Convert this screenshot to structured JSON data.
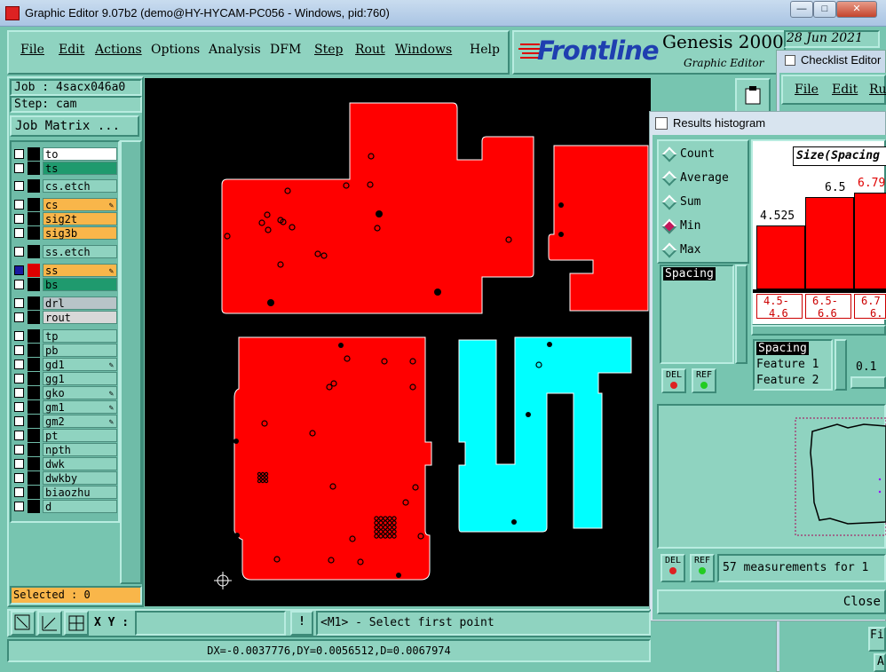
{
  "window": {
    "title": "Graphic Editor 9.07b2 (demo@HY-HYCAM-PC056 - Windows, pid:760)",
    "min": "—",
    "max": "□",
    "close": "✕"
  },
  "menu": [
    "File",
    "Edit",
    "Actions",
    "Options",
    "Analysis",
    "DFM",
    "Step",
    "Rout",
    "Windows",
    "Help"
  ],
  "brand": {
    "logo": "Frontline",
    "product": "Genesis 2000",
    "sub": "Graphic Editor",
    "date": "28 Jun 2021"
  },
  "job": {
    "job_label": "Job : 4sacx046a0",
    "step_label": "Step: cam",
    "matrix_button": "Job Matrix ..."
  },
  "layers": [
    {
      "name": "to",
      "bg": "#ffffff",
      "sel": false,
      "edit": false
    },
    {
      "name": "ts",
      "bg": "#1f9a6e",
      "sel": false,
      "edit": false
    },
    {
      "name": "cs.etch",
      "bg": "#8fd3c0",
      "sel": false,
      "edit": false
    },
    {
      "name": "cs",
      "bg": "#f9b64a",
      "sel": false,
      "edit": true
    },
    {
      "name": "sig2t",
      "bg": "#f9b64a",
      "sel": false,
      "edit": false
    },
    {
      "name": "sig3b",
      "bg": "#f9b64a",
      "sel": false,
      "edit": false
    },
    {
      "name": "ss.etch",
      "bg": "#8fd3c0",
      "sel": false,
      "edit": false
    },
    {
      "name": "ss",
      "bg": "#f9b64a",
      "sel": true,
      "edit": true
    },
    {
      "name": "bs",
      "bg": "#1f9a6e",
      "sel": false,
      "edit": false
    },
    {
      "name": "drl",
      "bg": "#b8c4c8",
      "sel": false,
      "edit": false
    },
    {
      "name": "rout",
      "bg": "#d8d8d8",
      "sel": false,
      "edit": false
    },
    {
      "name": "tp",
      "bg": "#8fd3c0",
      "sel": false,
      "edit": false
    },
    {
      "name": "pb",
      "bg": "#8fd3c0",
      "sel": false,
      "edit": false
    },
    {
      "name": "gd1",
      "bg": "#8fd3c0",
      "sel": false,
      "edit": true
    },
    {
      "name": "gg1",
      "bg": "#8fd3c0",
      "sel": false,
      "edit": false
    },
    {
      "name": "gko",
      "bg": "#8fd3c0",
      "sel": false,
      "edit": true
    },
    {
      "name": "gm1",
      "bg": "#8fd3c0",
      "sel": false,
      "edit": true
    },
    {
      "name": "gm2",
      "bg": "#8fd3c0",
      "sel": false,
      "edit": true
    },
    {
      "name": "pt",
      "bg": "#8fd3c0",
      "sel": false,
      "edit": false
    },
    {
      "name": "npth",
      "bg": "#8fd3c0",
      "sel": false,
      "edit": false
    },
    {
      "name": "dwk",
      "bg": "#8fd3c0",
      "sel": false,
      "edit": false
    },
    {
      "name": "dwkby",
      "bg": "#8fd3c0",
      "sel": false,
      "edit": false
    },
    {
      "name": "biaozhu",
      "bg": "#8fd3c0",
      "sel": false,
      "edit": false
    },
    {
      "name": "d",
      "bg": "#8fd3c0",
      "sel": false,
      "edit": false
    }
  ],
  "selected": "Selected : 0",
  "bottom": {
    "xy_label": "X Y :",
    "xy_value": "",
    "prompt": "<M1> - Select first point",
    "status": "DX=-0.0037776,DY=0.0056512,D=0.0067974",
    "bang": "!"
  },
  "checklist": {
    "title": "Checklist Editor",
    "menu": [
      "File",
      "Edit",
      "Ru"
    ]
  },
  "histogram": {
    "title": "Results histogram",
    "modes": [
      "Count",
      "Average",
      "Sum",
      "Min",
      "Max"
    ],
    "selected_mode": "Min",
    "list": [
      "Spacing"
    ],
    "chart_title": "Size(Spacing",
    "del": "DEL",
    "ref": "REF",
    "fields": [
      "Spacing",
      "Feature 1",
      "Feature 2"
    ],
    "value_field": "0.1",
    "measurements": "57 measurements for 1",
    "close": "Close",
    "right_edge_label": "Fi",
    "right_edge_btn": "A"
  },
  "chart_data": {
    "type": "bar",
    "title": "Size(Spacing",
    "categories": [
      "4.5-4.6",
      "6.5-6.6",
      "6.7"
    ],
    "bin_labels": [
      "4.5-",
      "4.6",
      "6.5-",
      "6.6",
      "6.7",
      "6."
    ],
    "values": [
      4.525,
      6.5,
      6.79
    ],
    "value_labels": [
      "4.525",
      "6.5",
      "6.79"
    ],
    "highlight_color": "#e00000",
    "bar_color": "#ff0000"
  },
  "colors": {
    "panel": "#77c5b0",
    "red_feature": "#ff0000",
    "cyan_feature": "#00ffff",
    "canvas": "#000000"
  }
}
